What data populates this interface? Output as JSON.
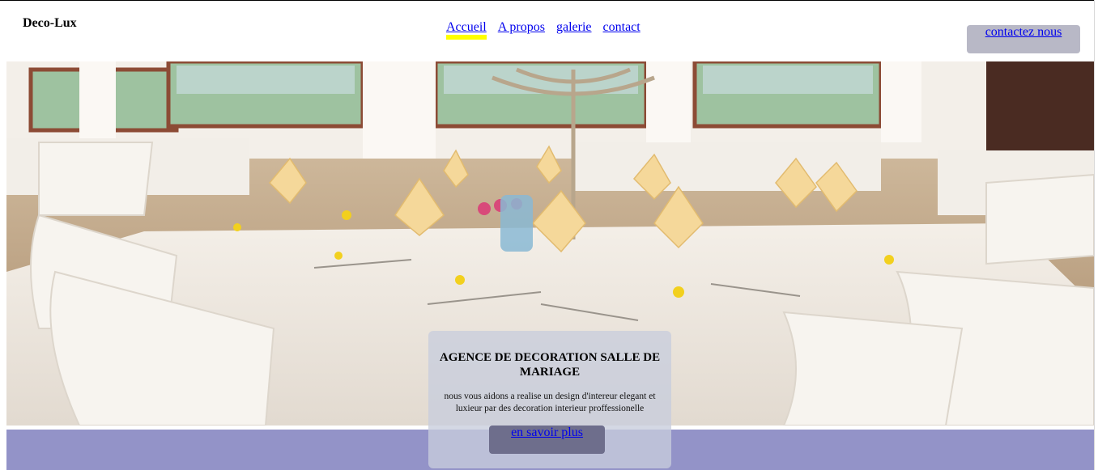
{
  "brand": {
    "name": "Deco-Lux"
  },
  "nav": {
    "items": [
      {
        "label": "Accueil",
        "active": true
      },
      {
        "label": "A propos"
      },
      {
        "label": "galerie"
      },
      {
        "label": "contact"
      }
    ]
  },
  "header": {
    "cta_label": "contactez nous"
  },
  "hero": {
    "image": "banquet-hall-photo",
    "title": "AGENCE DE DECORATION SALLE DE MARIAGE",
    "description": "nous vous aidons a realise un design d'intereur elegant et luxieur par des decoration interieur proffessionelle",
    "button_label": "en savoir plus"
  },
  "colors": {
    "nav_active_underline": "#ffff00",
    "cta_bg": "#b8b8c6",
    "footer_band": "#9393c8",
    "more_button_bg": "#6e6e8c",
    "link": "#0000ee"
  }
}
